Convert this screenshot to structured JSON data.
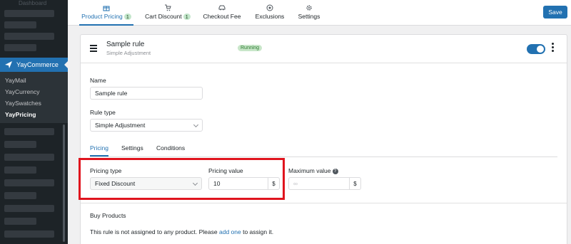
{
  "sidebar": {
    "faint_title": "Dashboard",
    "active_item": "YayCommerce",
    "submenu": [
      "YayMail",
      "YayCurrency",
      "YaySwatches",
      "YayPricing"
    ],
    "current": "YayPricing"
  },
  "tabs": [
    {
      "label": "Product Pricing",
      "badge": "1",
      "icon": "gift-icon"
    },
    {
      "label": "Cart Discount",
      "badge": "1",
      "icon": "cart-icon"
    },
    {
      "label": "Checkout Fee",
      "badge": "",
      "icon": "car-icon"
    },
    {
      "label": "Exclusions",
      "badge": "",
      "icon": "circle-dot-icon"
    },
    {
      "label": "Settings",
      "badge": "",
      "icon": "gear-icon"
    }
  ],
  "save_label": "Save",
  "rule": {
    "title": "Sample rule",
    "subtitle": "Simple Adjustment",
    "status": "Running",
    "name_label": "Name",
    "name_value": "Sample rule",
    "type_label": "Rule type",
    "type_value": "Simple Adjustment"
  },
  "subtabs": [
    "Pricing",
    "Settings",
    "Conditions"
  ],
  "pricing": {
    "type_label": "Pricing type",
    "type_value": "Fixed Discount",
    "value_label": "Pricing value",
    "value": "10",
    "value_suffix": "$",
    "max_label": "Maximum value",
    "max_placeholder": "∞",
    "max_suffix": "$"
  },
  "buy": {
    "heading": "Buy Products",
    "text_before": "This rule is not assigned to any product. Please",
    "link": "add one",
    "text_after": "to assign it."
  },
  "colors": {
    "accent": "#2271b1",
    "highlight": "#e0141e",
    "status_bg": "#c8e6c9"
  }
}
